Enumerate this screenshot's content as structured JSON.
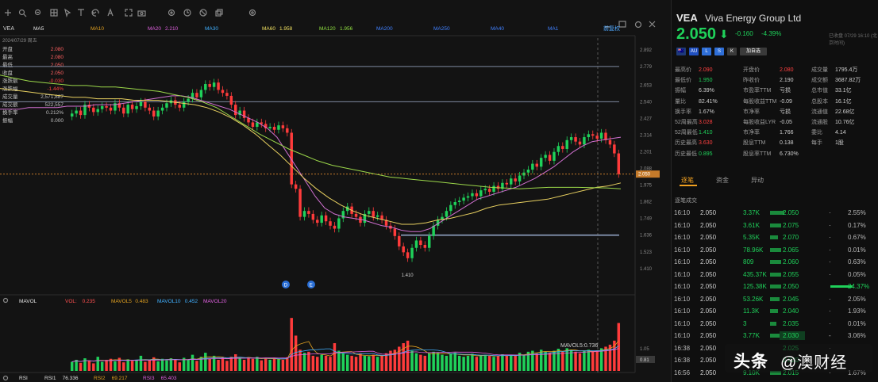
{
  "toolbar": {
    "icons": [
      "crosshair-icon",
      "zoom-in-icon",
      "zoom-out-icon",
      "grid-icon",
      "cursor-icon",
      "text-tool-icon",
      "undo-icon",
      "text-size-icon",
      "fullscreen-icon",
      "camera-icon",
      "settings-icon",
      "history-icon",
      "block-icon",
      "copy-icon",
      "gear-icon"
    ],
    "right_icons": [
      "minimize-icon",
      "popout-icon",
      "share-icon",
      "close-icon"
    ]
  },
  "chart_header": {
    "symbol": "VEA",
    "ma_items": [
      {
        "label": "MA5",
        "value": "",
        "color": "#e0e0e0"
      },
      {
        "label": "MA10",
        "value": "",
        "color": "#e0a020"
      },
      {
        "label": "MA20",
        "value": "2.210",
        "color": "#e060e0"
      },
      {
        "label": "MA30",
        "value": "",
        "color": "#40b0ff"
      },
      {
        "label": "MA60",
        "value": "1.958",
        "color": "#f0e060"
      },
      {
        "label": "MA120",
        "value": "1.956",
        "color": "#90e040"
      },
      {
        "label": "MA200",
        "value": "",
        "color": "#4080ff"
      },
      {
        "label": "MA250",
        "value": "",
        "color": "#4080ff"
      },
      {
        "label": "MA40",
        "value": "",
        "color": "#4080ff"
      },
      {
        "label": "MA1",
        "value": "",
        "color": "#4080ff"
      }
    ],
    "right_label": "前复权"
  },
  "left_info": {
    "title": "2024/07/29 周五",
    "rows": [
      {
        "label": "开盘",
        "value": "2.080"
      },
      {
        "label": "最高",
        "value": "2.080"
      },
      {
        "label": "最低",
        "value": "2.050"
      },
      {
        "label": "收盘",
        "value": "2.050"
      },
      {
        "label": "涨跌额",
        "value": "-0.030"
      },
      {
        "label": "涨跌幅",
        "value": "-1.44%"
      },
      {
        "label": "成交量",
        "value": "2,571,887"
      },
      {
        "label": "成交额",
        "value": "522,557"
      },
      {
        "label": "换手率",
        "value": "0.212%"
      },
      {
        "label": "振幅",
        "value": "0.000"
      }
    ]
  },
  "y_axis": [
    "2.892",
    "2.779",
    "2.653",
    "2.540",
    "2.427",
    "2.314",
    "2.201",
    "2.088",
    "1.975",
    "1.862",
    "1.749",
    "1.636",
    "1.523",
    "1.410"
  ],
  "price_markers": {
    "high_label": "",
    "low_label": "1.410",
    "current_price": "2.050"
  },
  "event_icons": [
    "event-icon-1",
    "event-icon-2"
  ],
  "volume_header": {
    "items": [
      {
        "label": "MAVOL",
        "value": "",
        "color": "#e0e0e0"
      },
      {
        "label": "VOL:",
        "value": "0.235",
        "color": "#ff5050"
      },
      {
        "label": "MAVOL5",
        "value": "0.483",
        "color": "#e0a020"
      },
      {
        "label": "MAVOL10",
        "value": "0.452",
        "color": "#40b0ff"
      },
      {
        "label": "MAVOL20",
        "value": "",
        "color": "#e060e0"
      }
    ],
    "mavol_readout": "MAVOL5:0.736",
    "axis": [
      "1.05",
      "0.81"
    ]
  },
  "rsi_bar": {
    "items": [
      {
        "label": "RSI",
        "value": "",
        "color": "#e0e0e0"
      },
      {
        "label": "RSI1",
        "value": "76.336",
        "color": "#e0e0e0"
      },
      {
        "label": "RSI2",
        "value": "69.217",
        "color": "#e0a020"
      },
      {
        "label": "RSI3",
        "value": "65.403",
        "color": "#e060e0"
      }
    ]
  },
  "quote": {
    "symbol": "VEA",
    "name": "Viva Energy Group Ltd",
    "price": "2.050",
    "change": "-0.160",
    "change_pct": "-4.39%",
    "timestamp": "已收盘 07/29 16:10 (北京时间)",
    "badges": [
      "🇦🇺",
      "AU",
      "L",
      "S",
      "K",
      "加自选"
    ]
  },
  "stats": [
    {
      "label": "最高价",
      "value": "2.090",
      "c": "#ff4040"
    },
    {
      "label": "开盘价",
      "value": "2.080",
      "c": "#ff4040"
    },
    {
      "label": "成交量",
      "value": "1795.4万",
      "c": "#cfcfcf"
    },
    {
      "label": "最低价",
      "value": "1.950",
      "c": "#1fd15a"
    },
    {
      "label": "昨收价",
      "value": "2.190",
      "c": "#cfcfcf"
    },
    {
      "label": "成交额",
      "value": "3687.82万",
      "c": "#cfcfcf"
    },
    {
      "label": "振幅",
      "value": "6.39%",
      "c": "#cfcfcf"
    },
    {
      "label": "市盈率TTM",
      "value": "亏损",
      "c": "#cfcfcf"
    },
    {
      "label": "总市值",
      "value": "33.1亿",
      "c": "#cfcfcf"
    },
    {
      "label": "量比",
      "value": "82.41%",
      "c": "#cfcfcf"
    },
    {
      "label": "每股收益TTM",
      "value": "-0.09",
      "c": "#cfcfcf"
    },
    {
      "label": "总股本",
      "value": "16.1亿",
      "c": "#cfcfcf"
    },
    {
      "label": "换手率",
      "value": "1.67%",
      "c": "#cfcfcf"
    },
    {
      "label": "市净率",
      "value": "亏损",
      "c": "#cfcfcf"
    },
    {
      "label": "流通值",
      "value": "22.68亿",
      "c": "#cfcfcf"
    },
    {
      "label": "52周最高",
      "value": "3.028",
      "c": "#ff4040"
    },
    {
      "label": "每股收益LYR",
      "value": "-0.05",
      "c": "#cfcfcf"
    },
    {
      "label": "流通股",
      "value": "10.76亿",
      "c": "#cfcfcf"
    },
    {
      "label": "52周最低",
      "value": "1.410",
      "c": "#1fd15a"
    },
    {
      "label": "市净率",
      "value": "1.766",
      "c": "#cfcfcf"
    },
    {
      "label": "委比",
      "value": "4.14",
      "c": "#cfcfcf"
    },
    {
      "label": "历史最高",
      "value": "3.630",
      "c": "#ff4040"
    },
    {
      "label": "股息TTM",
      "value": "0.138",
      "c": "#cfcfcf"
    },
    {
      "label": "每手",
      "value": "1股",
      "c": "#cfcfcf"
    },
    {
      "label": "历史最低",
      "value": "0.895",
      "c": "#1fd15a"
    },
    {
      "label": "股息率TTM",
      "value": "6.730%",
      "c": "#cfcfcf"
    },
    {
      "label": "",
      "value": "",
      "c": "#cfcfcf"
    }
  ],
  "tabs": [
    "逐笔",
    "资金",
    "异动"
  ],
  "section_label": "逐笔成交",
  "trades": [
    {
      "time": "16:10",
      "price": "2.050",
      "vol": "3.37K",
      "bar": 18,
      "bid": "2.050",
      "dot": "·",
      "pct": "2.55%",
      "pctbar": 0
    },
    {
      "time": "16:10",
      "price": "2.050",
      "vol": "3.61K",
      "bar": 14,
      "bid": "2.075",
      "dot": "·",
      "pct": "0.17%",
      "pctbar": 0
    },
    {
      "time": "16:10",
      "price": "2.050",
      "vol": "5.35K",
      "bar": 10,
      "bid": "2.070",
      "dot": "·",
      "pct": "0.67%",
      "pctbar": 0
    },
    {
      "time": "16:10",
      "price": "2.050",
      "vol": "78.96K",
      "bar": 14,
      "bid": "2.065",
      "dot": "·",
      "pct": "0.01%",
      "pctbar": 0
    },
    {
      "time": "16:10",
      "price": "2.050",
      "vol": "809",
      "bar": 14,
      "bid": "2.060",
      "dot": "·",
      "pct": "0.63%",
      "pctbar": 0
    },
    {
      "time": "16:10",
      "price": "2.050",
      "vol": "435.37K",
      "bar": 14,
      "bid": "2.055",
      "dot": "·",
      "pct": "0.05%",
      "pctbar": 0
    },
    {
      "time": "16:10",
      "price": "2.050",
      "vol": "125.38K",
      "bar": 14,
      "bid": "2.050",
      "dot": "",
      "pct": "24.37%",
      "pctbar": 28,
      "hl": true
    },
    {
      "time": "16:10",
      "price": "2.050",
      "vol": "53.26K",
      "bar": 12,
      "bid": "2.045",
      "dot": "·",
      "pct": "2.05%",
      "pctbar": 0
    },
    {
      "time": "16:10",
      "price": "2.050",
      "vol": "11.3K",
      "bar": 10,
      "bid": "2.040",
      "dot": "·",
      "pct": "1.93%",
      "pctbar": 0
    },
    {
      "time": "16:10",
      "price": "2.050",
      "vol": "3",
      "bar": 8,
      "bid": "2.035",
      "dot": "·",
      "pct": "0.01%",
      "pctbar": 0
    },
    {
      "time": "16:10",
      "price": "2.050",
      "vol": "3.77K",
      "bar": 14,
      "bid": "2.030",
      "dot": "-",
      "pct": "3.06%",
      "pctbar": 0,
      "box": true
    },
    {
      "time": "16:38",
      "price": "2.050",
      "vol": "",
      "bar": 0,
      "bid": "2.025",
      "dot": "·",
      "pct": "",
      "pctbar": 0
    },
    {
      "time": "16:38",
      "price": "2.050",
      "vol": "",
      "bar": 0,
      "bid": "2.020",
      "dot": "·",
      "pct": "",
      "pctbar": 0
    },
    {
      "time": "16:56",
      "price": "2.050",
      "vol": "9.10K",
      "bar": 14,
      "bid": "2.015",
      "dot": "·",
      "pct": "1.67%",
      "pctbar": 0
    }
  ],
  "watermark": {
    "logo": "头条",
    "name": "@澳财经"
  },
  "chart_data": {
    "type": "candlestick",
    "symbol": "VEA",
    "ylim": [
      1.35,
      2.95
    ],
    "y_ticks": [
      2.892,
      2.779,
      2.653,
      2.54,
      2.427,
      2.314,
      2.201,
      2.088,
      1.975,
      1.862,
      1.749,
      1.636,
      1.523,
      1.41
    ],
    "series_close": [
      2.46,
      2.48,
      2.45,
      2.52,
      2.5,
      2.47,
      2.49,
      2.51,
      2.5,
      2.48,
      2.53,
      2.5,
      2.46,
      2.52,
      2.49,
      2.51,
      2.54,
      2.5,
      2.48,
      2.44,
      2.48,
      2.5,
      2.53,
      2.55,
      2.52,
      2.5,
      2.54,
      2.56,
      2.6,
      2.57,
      2.62,
      2.66,
      2.64,
      2.67,
      2.62,
      2.6,
      2.58,
      2.52,
      2.45,
      2.48,
      2.43,
      2.4,
      2.37,
      2.4,
      2.39,
      2.36,
      2.37,
      2.35,
      2.38,
      2.36,
      2.33,
      1.98,
      1.95,
      1.76,
      1.8,
      1.78,
      1.74,
      1.72,
      1.77,
      1.73,
      1.7,
      1.68,
      1.75,
      1.8,
      1.83,
      1.78,
      1.76,
      1.72,
      1.78,
      1.8,
      1.76,
      1.77,
      1.74,
      1.7,
      1.68,
      1.63,
      1.56,
      1.52,
      1.48,
      1.55,
      1.6,
      1.57,
      1.55,
      1.63,
      1.7,
      1.74,
      1.76,
      1.8,
      1.84,
      1.86,
      1.87,
      1.89,
      1.9,
      1.92,
      1.9,
      1.94,
      1.95,
      1.93,
      1.97,
      1.95,
      1.99,
      1.98,
      2.02,
      2.0,
      2.04,
      2.06,
      2.08,
      2.12,
      2.1,
      2.16,
      2.18,
      2.14,
      2.2,
      2.24,
      2.22,
      2.28,
      2.3,
      2.27,
      2.25,
      2.3,
      2.32,
      2.31,
      2.29,
      2.33,
      2.28,
      2.25,
      2.19,
      2.05
    ],
    "low_marker": {
      "value": 1.41,
      "label": "1.410"
    },
    "horizontal_lines": [
      2.779,
      2.54,
      1.636
    ],
    "current_price": 2.05,
    "ma_series": [
      {
        "name": "MA20",
        "values": [
          2.49,
          2.49,
          2.49,
          2.5,
          2.5,
          2.5,
          2.5,
          2.51,
          2.51,
          2.51,
          2.52,
          2.52,
          2.52,
          2.53,
          2.54,
          2.55,
          2.56,
          2.57,
          2.58,
          2.58,
          2.57,
          2.55,
          2.53,
          2.51,
          2.49,
          2.46,
          2.43,
          2.4,
          2.36,
          2.3,
          2.2,
          2.1,
          2.0,
          1.9,
          1.82,
          1.78,
          1.76,
          1.75,
          1.74,
          1.72,
          1.7,
          1.69,
          1.67,
          1.66,
          1.66,
          1.68,
          1.72,
          1.76,
          1.8,
          1.84,
          1.88,
          1.9,
          1.92,
          1.94,
          1.96,
          1.99,
          2.02,
          2.06,
          2.1,
          2.15,
          2.2,
          2.24,
          2.27,
          2.28,
          2.29,
          2.3
        ]
      },
      {
        "name": "MA60",
        "values": [
          2.63,
          2.62,
          2.61,
          2.6,
          2.59,
          2.58,
          2.57,
          2.57,
          2.56,
          2.56,
          2.56,
          2.55,
          2.55,
          2.55,
          2.54,
          2.53,
          2.52,
          2.5,
          2.47,
          2.43,
          2.38,
          2.32,
          2.25,
          2.18,
          2.1,
          2.02,
          1.95,
          1.89,
          1.84,
          1.8,
          1.77,
          1.75,
          1.73,
          1.71,
          1.71,
          1.72,
          1.74,
          1.75,
          1.77,
          1.79,
          1.82,
          1.84,
          1.85,
          1.86,
          1.87,
          1.88,
          1.9,
          1.92,
          1.94,
          1.96,
          1.97,
          1.99
        ]
      },
      {
        "name": "MA120",
        "values": [
          2.72,
          2.7,
          2.68,
          2.67,
          2.66,
          2.65,
          2.65,
          2.64,
          2.64,
          2.63,
          2.62,
          2.61,
          2.59,
          2.57,
          2.54,
          2.5,
          2.44,
          2.38,
          2.32,
          2.27,
          2.22,
          2.18,
          2.14,
          2.11,
          2.09,
          2.07,
          2.05,
          2.03,
          2.02,
          2.01,
          2.0,
          1.99,
          1.98,
          1.97,
          1.96,
          1.955,
          1.95,
          1.955,
          1.96,
          1.96,
          1.96,
          1.958,
          1.956,
          1.95
        ]
      }
    ],
    "volume": [
      0.18,
      0.22,
      0.16,
      0.25,
      0.2,
      0.15,
      0.28,
      0.18,
      0.22,
      0.24,
      0.19,
      0.26,
      0.17,
      0.23,
      0.2,
      0.21,
      0.3,
      0.18,
      0.22,
      0.27,
      0.19,
      0.24,
      0.21,
      0.25,
      0.23,
      0.17,
      0.26,
      0.22,
      0.32,
      0.2,
      0.28,
      0.36,
      0.24,
      0.3,
      0.22,
      0.26,
      0.2,
      0.28,
      0.33,
      0.25,
      0.22,
      0.26,
      0.24,
      0.28,
      0.21,
      0.25,
      0.22,
      0.26,
      0.23,
      0.22,
      0.27,
      1.05,
      0.7,
      0.42,
      0.36,
      0.38,
      0.3,
      0.28,
      0.32,
      0.3,
      0.28,
      0.55,
      0.4,
      0.35,
      0.32,
      0.3,
      0.28,
      0.34,
      0.3,
      0.29,
      0.32,
      0.28,
      0.3,
      0.35,
      0.4,
      0.42,
      0.48,
      0.55,
      0.6,
      0.4,
      0.35,
      0.32,
      0.3,
      0.35,
      0.38,
      0.36,
      0.32,
      0.3,
      0.34,
      0.36,
      0.3,
      0.28,
      0.3,
      0.34,
      0.28,
      0.3,
      0.32,
      0.3,
      0.28,
      0.3,
      0.33,
      0.3,
      0.32,
      0.3,
      0.36,
      0.32,
      0.38,
      0.4,
      0.35,
      0.42,
      0.38,
      0.36,
      0.4,
      0.44,
      0.38,
      0.45,
      0.42,
      0.38,
      0.35,
      0.4,
      0.42,
      0.38,
      0.4,
      0.45,
      0.48,
      0.52,
      0.6,
      0.95
    ]
  }
}
